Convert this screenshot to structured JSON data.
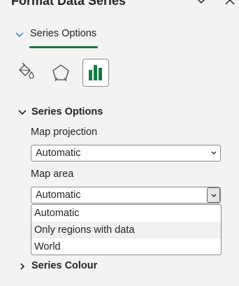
{
  "pane": {
    "title": "Format Data Series"
  },
  "tab": {
    "label": "Series Options"
  },
  "icon_tabs": [
    {
      "icon": "fill-line-icon"
    },
    {
      "icon": "effects-pentagon-icon"
    },
    {
      "icon": "series-options-bar-chart-icon",
      "selected": true
    }
  ],
  "series_options": {
    "header": "Series Options",
    "map_projection": {
      "label": "Map projection",
      "value": "Automatic"
    },
    "map_area": {
      "label": "Map area",
      "value": "Automatic",
      "options": [
        "Automatic",
        "Only regions with data",
        "World"
      ],
      "hovered_option": "Only regions with data"
    }
  },
  "series_colour": {
    "header": "Series Colour"
  },
  "colors": {
    "accent": "#107c41",
    "pane_bg": "#f3f3f3"
  }
}
